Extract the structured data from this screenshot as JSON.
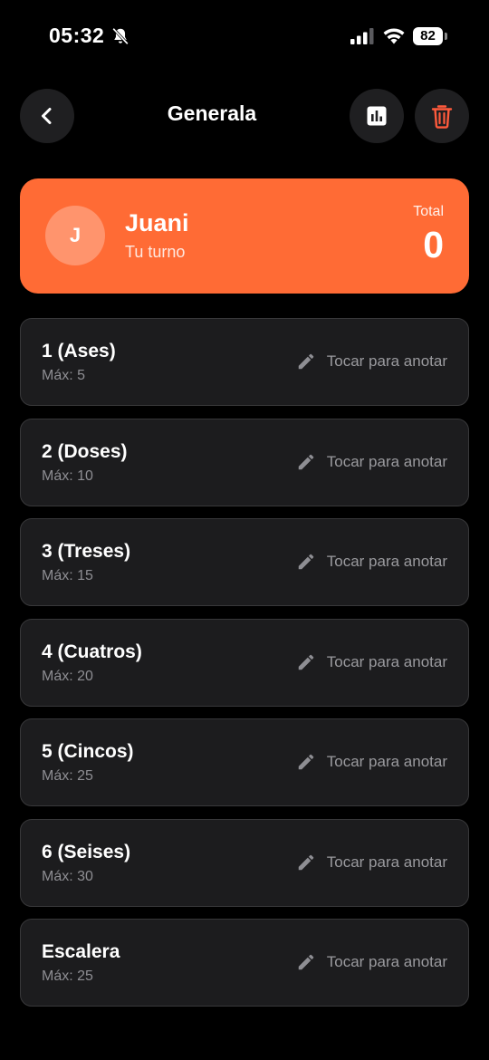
{
  "status_bar": {
    "time": "05:32",
    "battery": "82"
  },
  "header": {
    "title": "Generala"
  },
  "player": {
    "initial": "J",
    "name": "Juani",
    "subtitle": "Tu turno",
    "total_label": "Total",
    "total_value": "0"
  },
  "rows": [
    {
      "title": "1 (Ases)",
      "max": "Máx: 5",
      "action": "Tocar para anotar"
    },
    {
      "title": "2 (Doses)",
      "max": "Máx: 10",
      "action": "Tocar para anotar"
    },
    {
      "title": "3 (Treses)",
      "max": "Máx: 15",
      "action": "Tocar para anotar"
    },
    {
      "title": "4 (Cuatros)",
      "max": "Máx: 20",
      "action": "Tocar para anotar"
    },
    {
      "title": "5 (Cincos)",
      "max": "Máx: 25",
      "action": "Tocar para anotar"
    },
    {
      "title": "6 (Seises)",
      "max": "Máx: 30",
      "action": "Tocar para anotar"
    },
    {
      "title": "Escalera",
      "max": "Máx: 25",
      "action": "Tocar para anotar"
    }
  ],
  "colors": {
    "accent": "#ff6b35",
    "delete": "#ff5a3c",
    "card": "#1c1c1e"
  }
}
